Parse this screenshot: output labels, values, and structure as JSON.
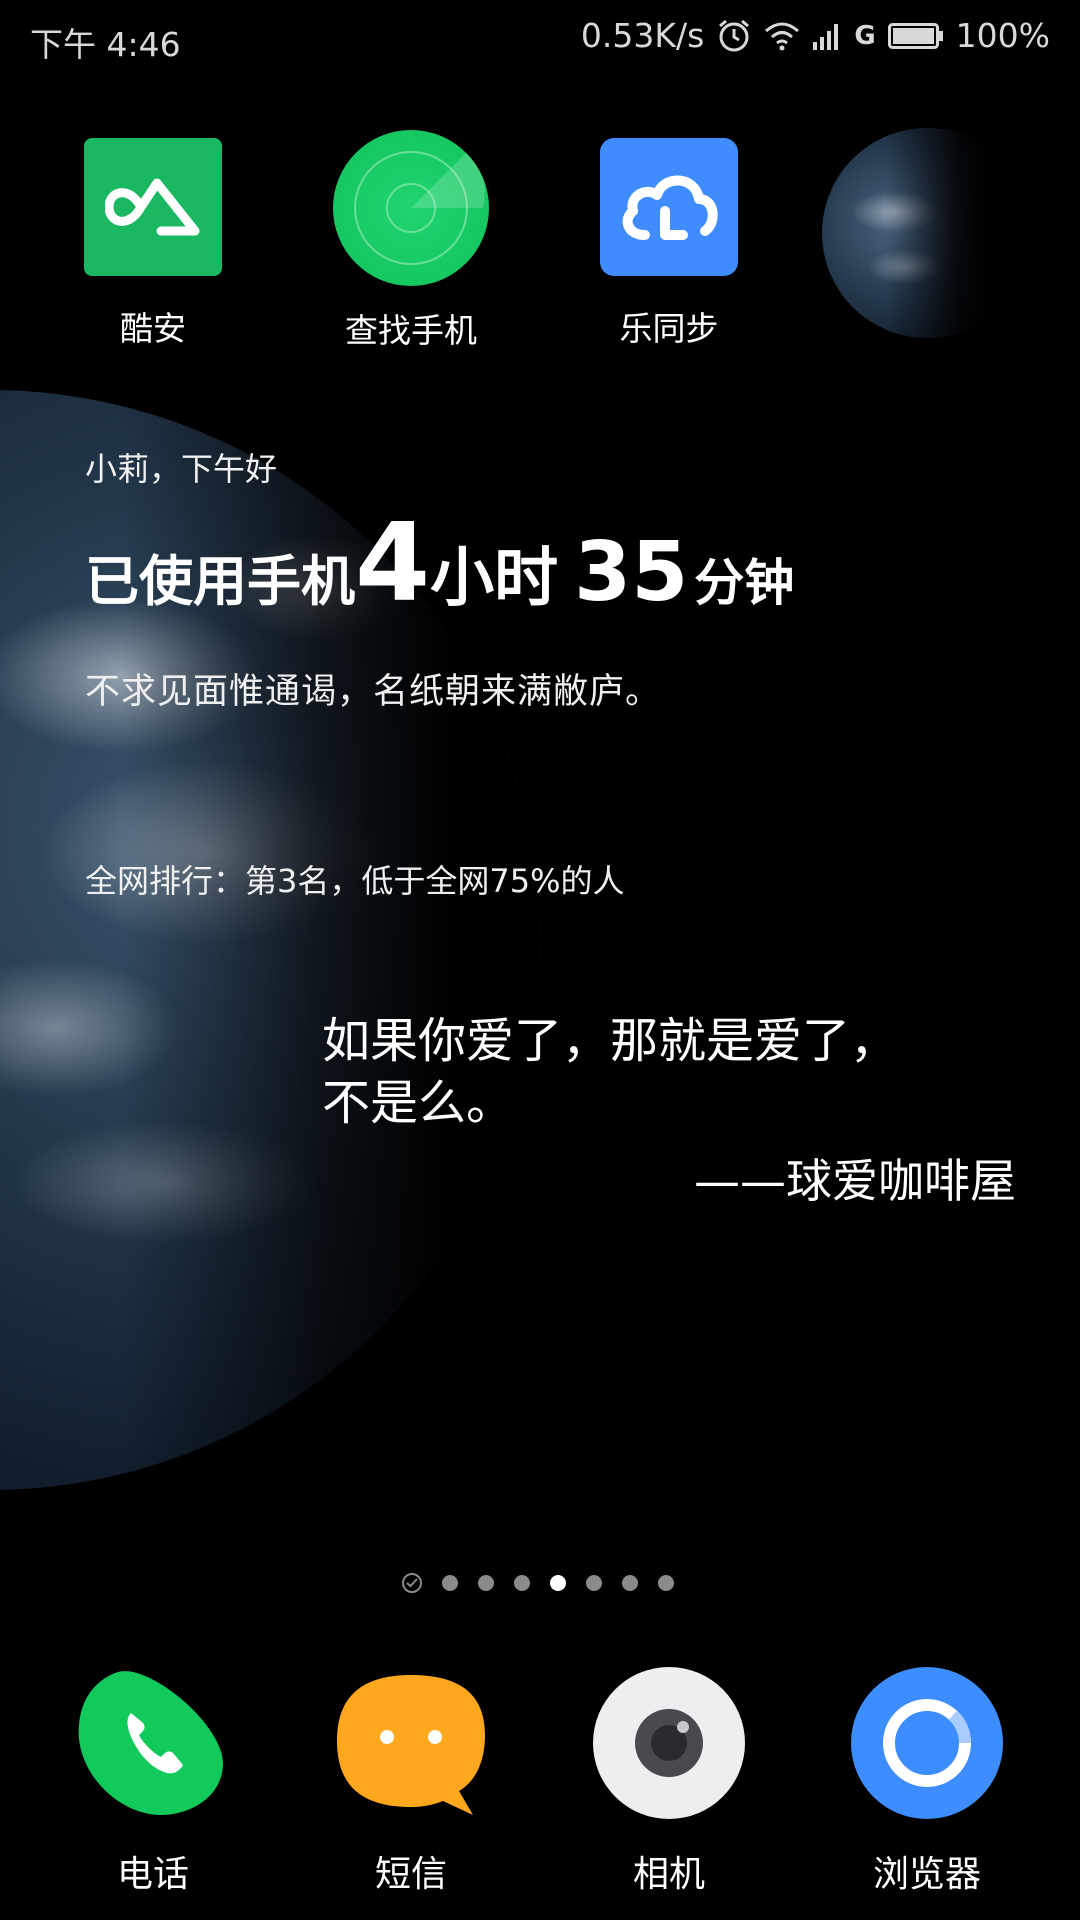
{
  "status_bar": {
    "time": "下午 4:46",
    "network_speed": "0.53K/s",
    "network_type": "G",
    "battery": "100%",
    "icons": [
      "alarm-icon",
      "wifi-icon",
      "signal-icon",
      "battery-icon"
    ]
  },
  "top_apps": [
    {
      "label": "酷安",
      "icon": "coolapk-icon",
      "color": "#19b861"
    },
    {
      "label": "查找手机",
      "icon": "radar-icon",
      "color": "#12c25a"
    },
    {
      "label": "乐同步",
      "icon": "cloud-sync-icon",
      "color": "#3f8cff"
    }
  ],
  "widget": {
    "greeting": "小莉，下午好",
    "usage_prefix": "已使用手机",
    "hours": "4",
    "hours_unit": "小时",
    "minutes": "35",
    "minutes_unit": "分钟",
    "poem": "不求见面惟通谒，名纸朝来满敝庐。",
    "ranking": "全网排行：第3名，低于全网75%的人"
  },
  "quote": {
    "line1": "如果你爱了，那就是爱了，",
    "line2": "不是么。",
    "source": "——球爱咖啡屋"
  },
  "page_indicator": {
    "count": 8,
    "active_index": 4
  },
  "dock": [
    {
      "label": "电话",
      "icon": "phone-icon",
      "color": "#12c95c"
    },
    {
      "label": "短信",
      "icon": "message-icon",
      "color": "#ffa81e"
    },
    {
      "label": "相机",
      "icon": "camera-icon",
      "color": "#eeeef0"
    },
    {
      "label": "浏览器",
      "icon": "browser-icon",
      "color": "#3d8dff"
    }
  ]
}
